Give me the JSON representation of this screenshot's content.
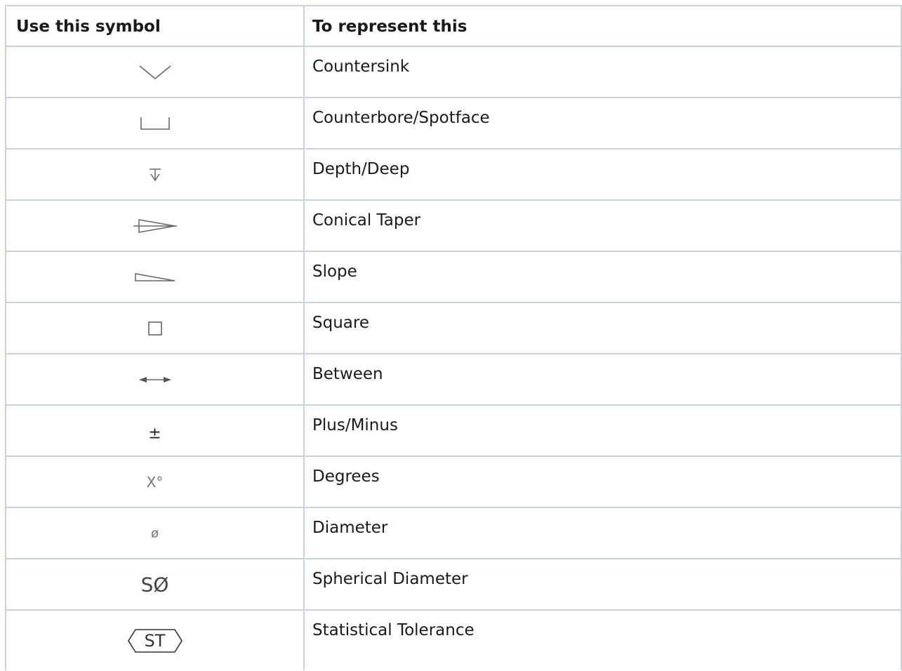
{
  "table": {
    "header_symbol": "Use this symbol",
    "header_meaning": "To represent this",
    "rows": [
      {
        "icon": "countersink-icon",
        "label": "Countersink"
      },
      {
        "icon": "counterbore-icon",
        "label": "Counterbore/Spotface"
      },
      {
        "icon": "depth-icon",
        "label": "Depth/Deep"
      },
      {
        "icon": "conical-taper-icon",
        "label": "Conical Taper"
      },
      {
        "icon": "slope-icon",
        "label": "Slope"
      },
      {
        "icon": "square-icon",
        "label": "Square"
      },
      {
        "icon": "between-icon",
        "label": "Between"
      },
      {
        "icon": "plus-minus-icon",
        "label": "Plus/Minus",
        "glyph": "±"
      },
      {
        "icon": "degrees-icon",
        "label": "Degrees",
        "glyph": "X°"
      },
      {
        "icon": "diameter-icon",
        "label": "Diameter",
        "glyph": "ø"
      },
      {
        "icon": "spherical-diameter-icon",
        "label": "Spherical Diameter",
        "glyph": "SØ"
      },
      {
        "icon": "statistical-tolerance-icon",
        "label": "Statistical Tolerance",
        "glyph": "ST"
      }
    ]
  },
  "colors": {
    "border": "#c9d2dc",
    "symbol_stroke": "#666666"
  }
}
